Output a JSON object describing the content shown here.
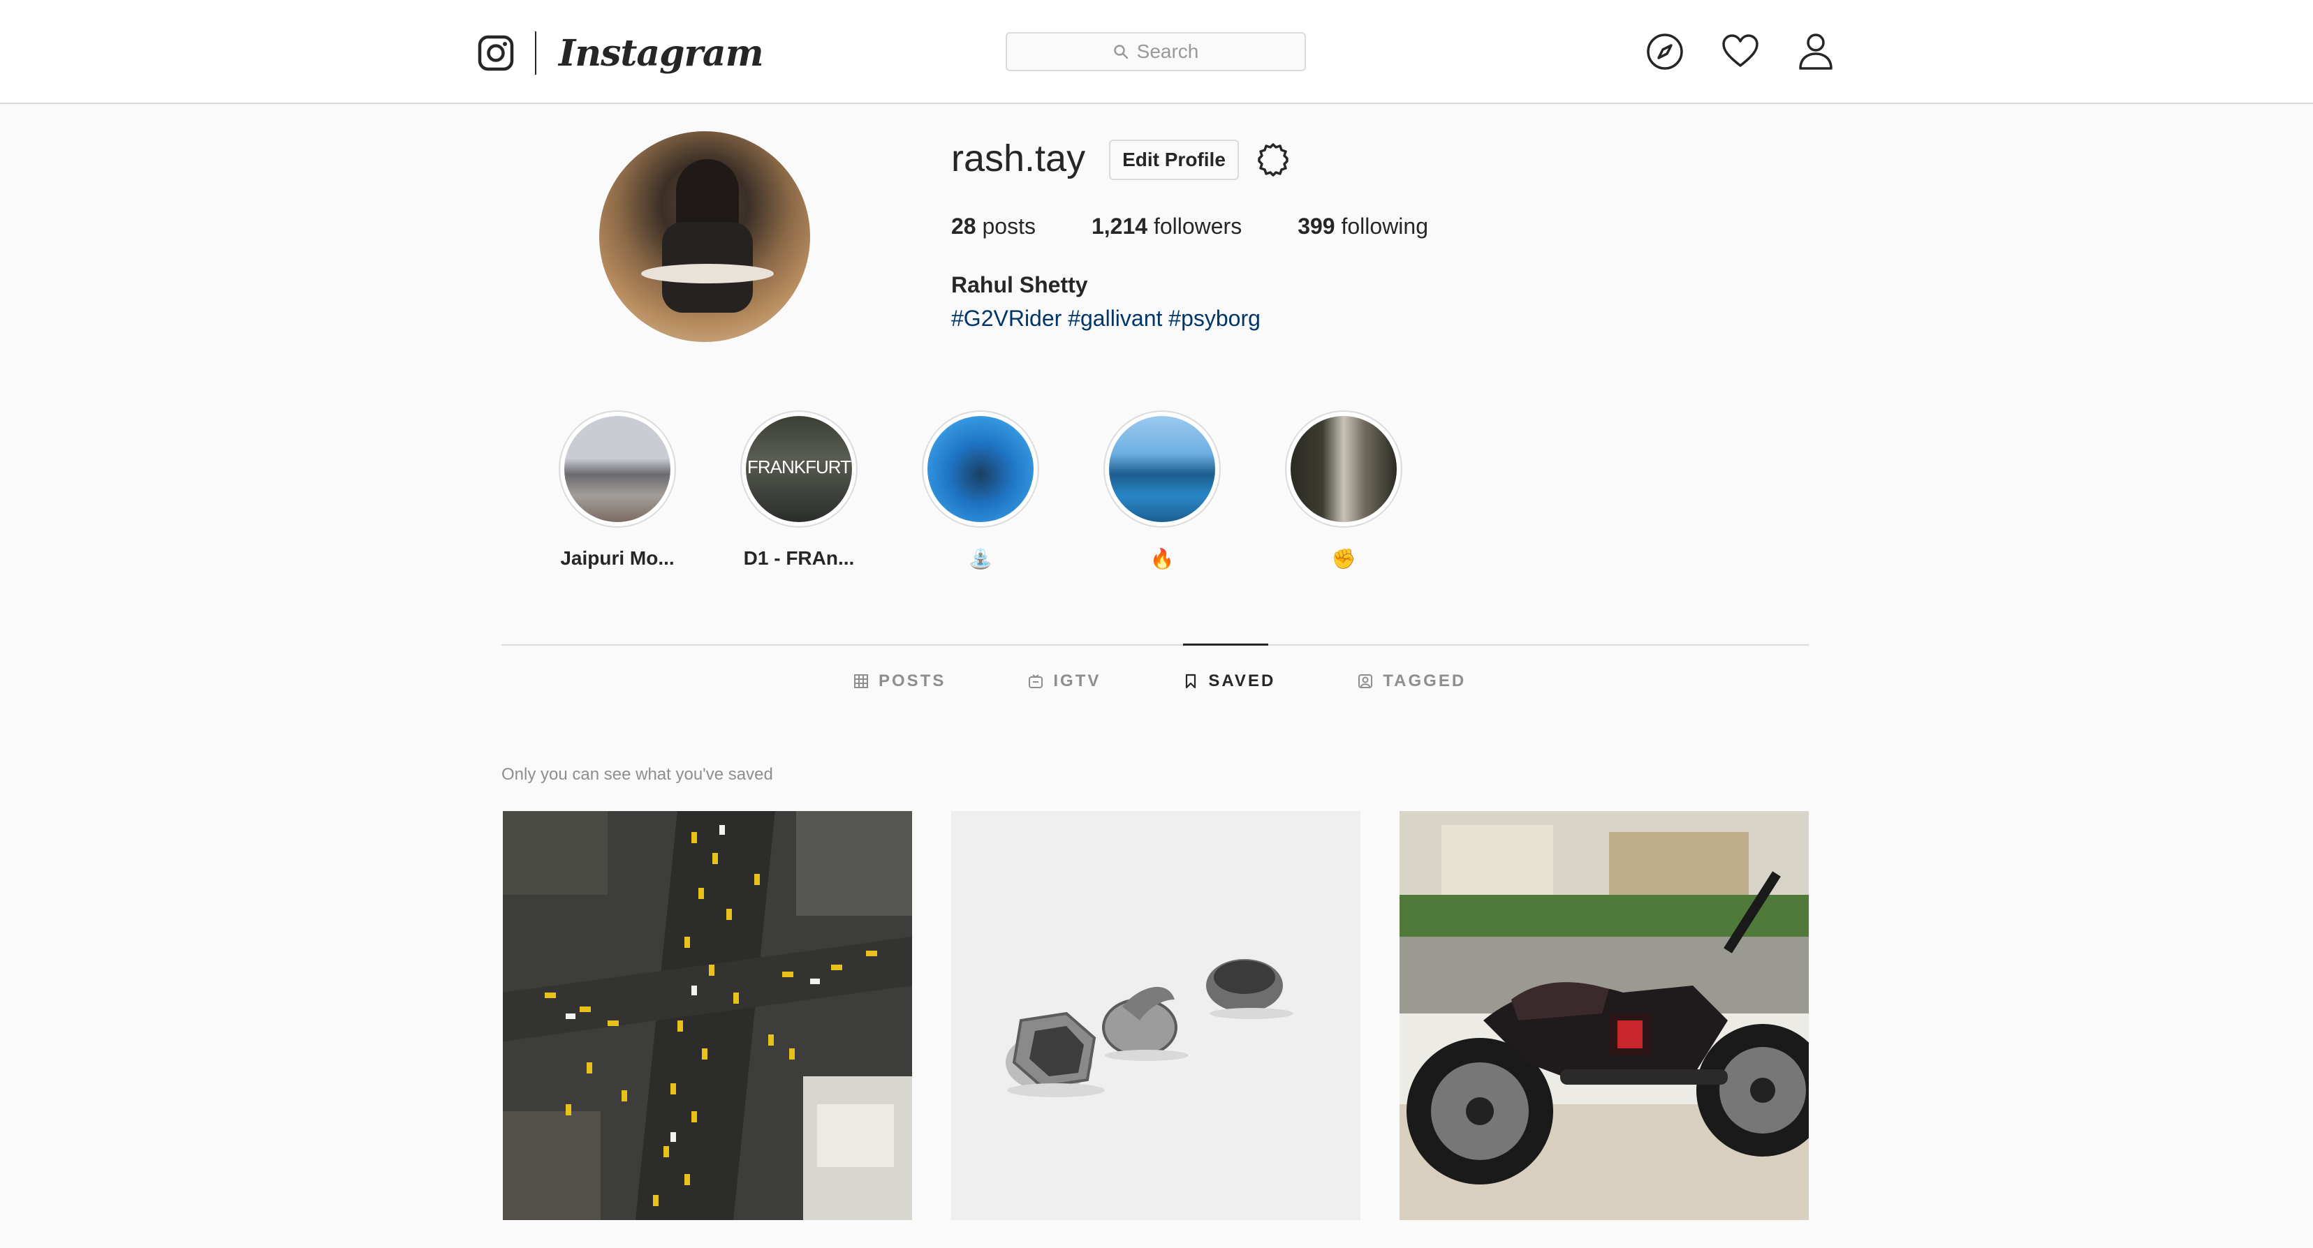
{
  "nav": {
    "brand": "Instagram",
    "search_placeholder": "Search",
    "icons": [
      "compass-icon",
      "heart-icon",
      "user-icon"
    ]
  },
  "profile": {
    "username": "rash.tay",
    "edit_label": "Edit Profile",
    "posts_count": "28",
    "posts_label": "posts",
    "followers_count": "1,214",
    "followers_label": "followers",
    "following_count": "399",
    "following_label": "following",
    "full_name": "Rahul Shetty",
    "bio": "#G2VRider #gallivant #psyborg"
  },
  "highlights": [
    {
      "label": "Jaipuri Mo...",
      "image_text": ""
    },
    {
      "label": "D1 - FRAn...",
      "image_text": "FRANKFURT"
    },
    {
      "label": "⛲",
      "image_text": ""
    },
    {
      "label": "🔥",
      "image_text": ""
    },
    {
      "label": "✊",
      "image_text": ""
    }
  ],
  "tabs": [
    {
      "label": "POSTS",
      "active": false
    },
    {
      "label": "IGTV",
      "active": false
    },
    {
      "label": "SAVED",
      "active": true
    },
    {
      "label": "TAGGED",
      "active": false
    }
  ],
  "saved_note": "Only you can see what you've saved",
  "colors": {
    "background": "#fafafa",
    "border": "#dbdbdb",
    "text": "#262626",
    "muted": "#8e8e8e",
    "hashtag": "#003569"
  }
}
